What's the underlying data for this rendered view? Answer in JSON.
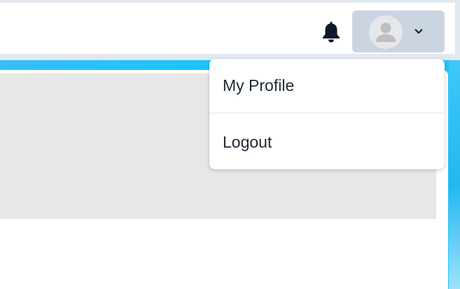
{
  "header": {
    "notification_icon": "bell-icon",
    "user_menu": {
      "avatar_icon": "user-avatar-icon",
      "toggle_icon": "chevron-down-icon"
    }
  },
  "user_dropdown": {
    "items": [
      {
        "label": "My Profile"
      },
      {
        "label": "Logout"
      }
    ]
  },
  "colors": {
    "topbar_bg": "#ffffff",
    "user_button_bg": "#cbd5e1",
    "accent_blue": "#0ec8ff",
    "panel_gray": "#e7e7e7",
    "menu_text": "#1f2937"
  }
}
